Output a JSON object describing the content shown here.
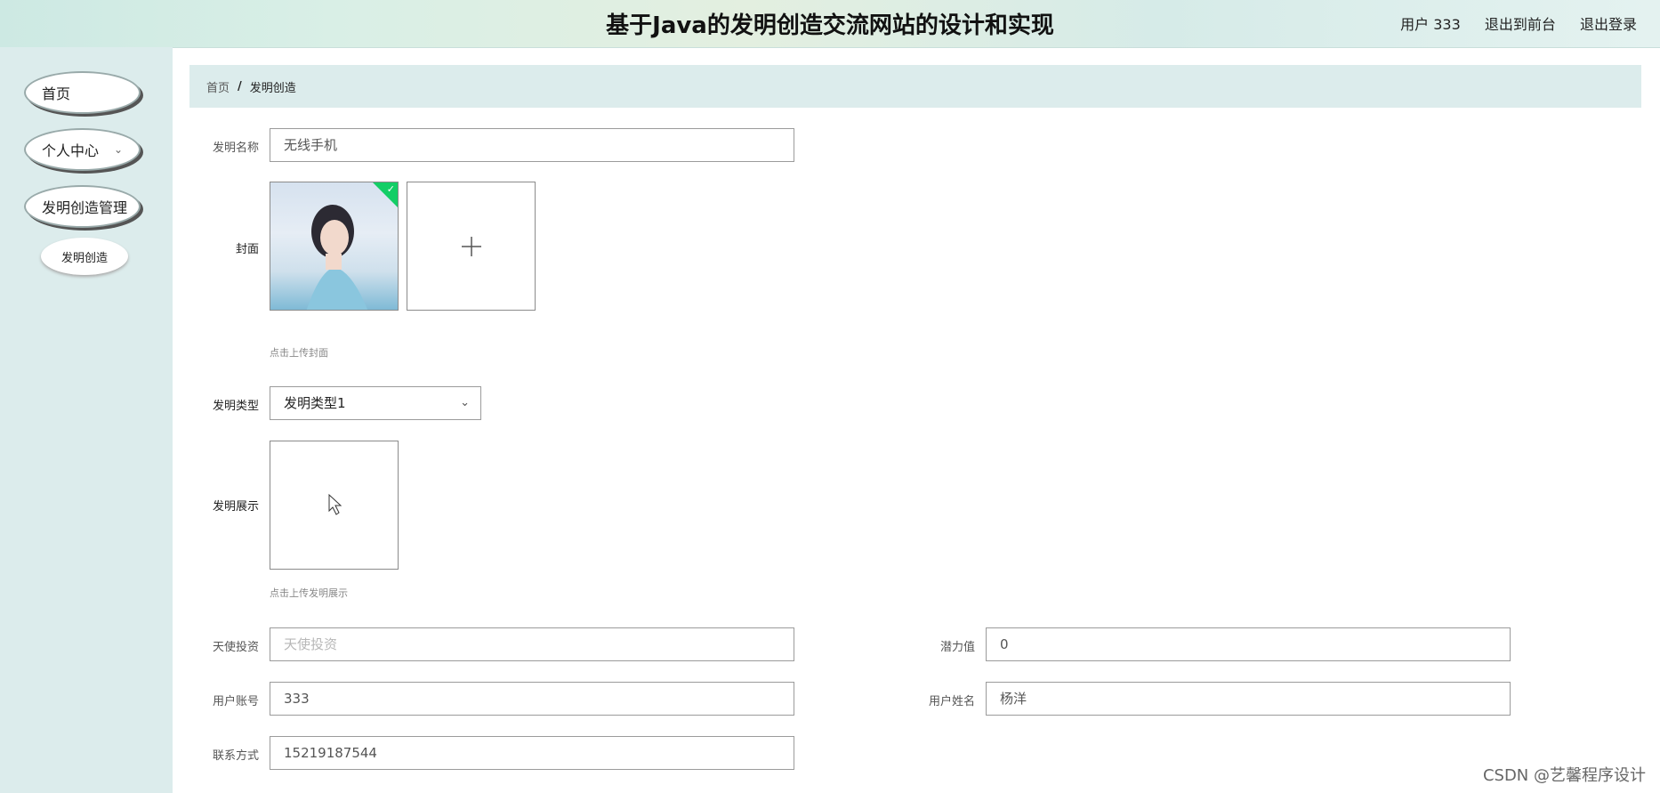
{
  "header": {
    "title": "基于Java的发明创造交流网站的设计和实现",
    "user_label": "用户 333",
    "back_link": "退出到前台",
    "logout_link": "退出登录"
  },
  "sidebar": {
    "items": [
      {
        "label": "首页"
      },
      {
        "label": "个人中心"
      },
      {
        "label": "发明创造管理"
      }
    ],
    "sub_item": "发明创造"
  },
  "breadcrumb": {
    "home": "首页",
    "separator": "/",
    "current": "发明创造"
  },
  "form": {
    "name_label": "发明名称",
    "name_value": "无线手机",
    "cover_label": "封面",
    "cover_hint": "点击上传封面",
    "type_label": "发明类型",
    "type_value": "发明类型1",
    "display_label": "发明展示",
    "display_hint": "点击上传发明展示",
    "angel_label": "天使投资",
    "angel_placeholder": "天使投资",
    "potential_label": "潜力值",
    "potential_value": "0",
    "account_label": "用户账号",
    "account_value": "333",
    "username_label": "用户姓名",
    "username_value": "杨洋",
    "contact_label": "联系方式",
    "contact_value": "15219187544"
  },
  "watermark": "CSDN @艺馨程序设计",
  "colors": {
    "accent_check": "#13ce66",
    "sidebar_bg": "#dcecec"
  }
}
